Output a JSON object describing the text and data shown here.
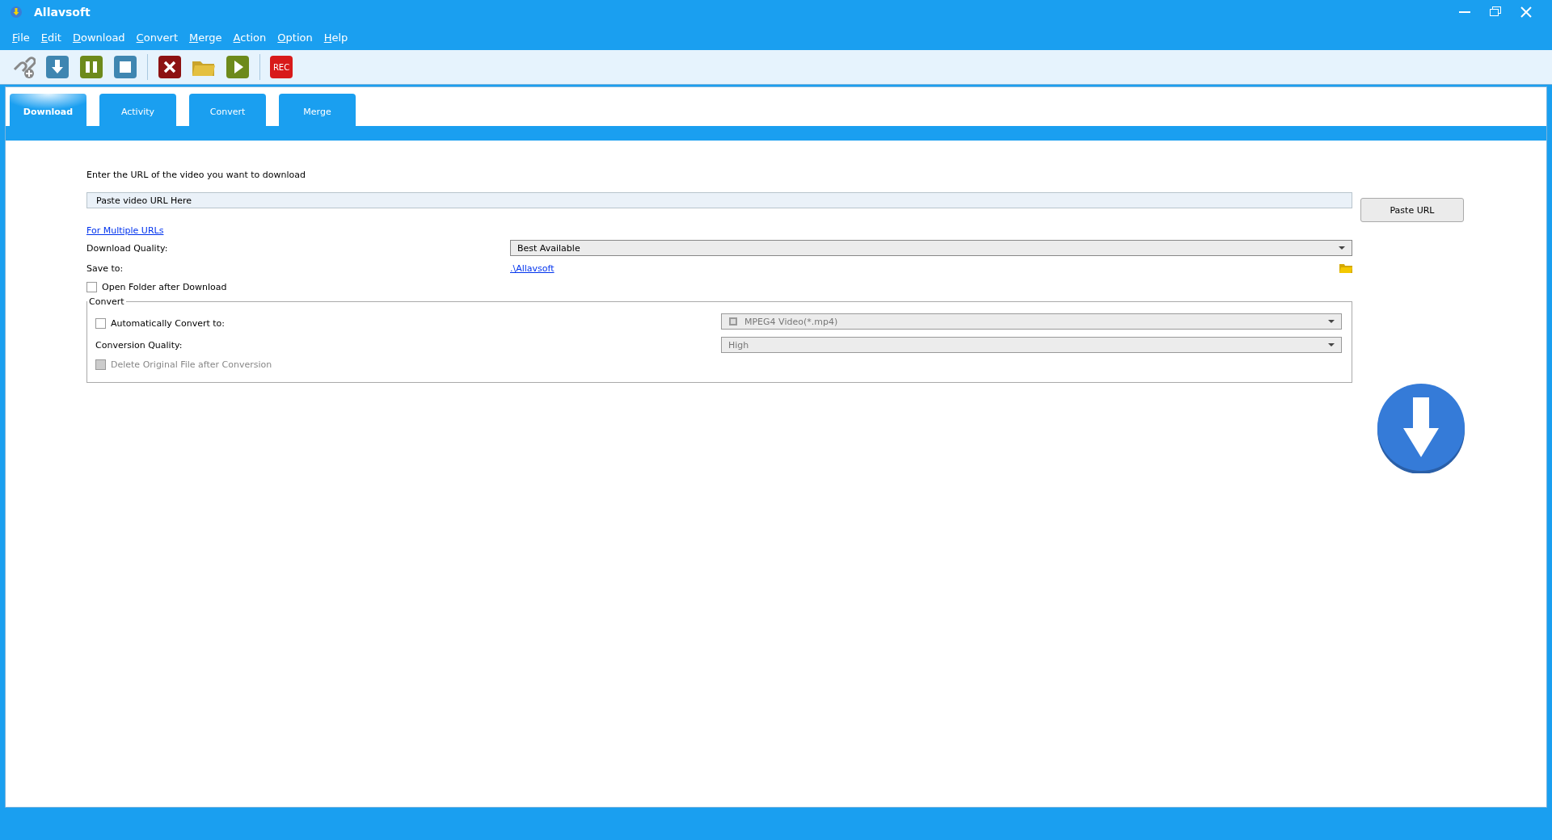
{
  "window": {
    "title": "Allavsoft"
  },
  "menu": [
    "File",
    "Edit",
    "Download",
    "Convert",
    "Merge",
    "Action",
    "Option",
    "Help"
  ],
  "toolbar": [
    {
      "kind": "link"
    },
    {
      "kind": "download"
    },
    {
      "kind": "pause"
    },
    {
      "kind": "stop"
    },
    {
      "kind": "sep"
    },
    {
      "kind": "cancel"
    },
    {
      "kind": "folder"
    },
    {
      "kind": "play"
    },
    {
      "kind": "sep"
    },
    {
      "kind": "rec",
      "label": "REC"
    }
  ],
  "tabs": [
    {
      "label": "Download",
      "selected": true
    },
    {
      "label": "Activity",
      "selected": false
    },
    {
      "label": "Convert",
      "selected": false
    },
    {
      "label": "Merge",
      "selected": false
    }
  ],
  "download": {
    "prompt": "Enter the URL of the video you want to download",
    "url_field": {
      "placeholder": "Paste video URL Here"
    },
    "paste_button": "Paste URL",
    "multiple_link": "For Multiple URLs",
    "quality_label": "Download Quality:",
    "quality": {
      "value": "Best Available",
      "disabled": false
    },
    "save_label": "Save to:",
    "save_path": ".\\Allavsoft",
    "open_folder": {
      "label": "Open Folder after Download",
      "checked": false,
      "disabled": false
    }
  },
  "convert": {
    "title": "Convert",
    "auto": {
      "label": "Automatically Convert to:",
      "checked": false,
      "disabled": false
    },
    "format": {
      "value": "MPEG4 Video(*.mp4)",
      "disabled": true
    },
    "quality_label": "Conversion Quality:",
    "quality": {
      "value": "High",
      "disabled": true
    },
    "delete_original": {
      "label": "Delete Original File after Conversion",
      "checked": false,
      "disabled": true
    }
  }
}
